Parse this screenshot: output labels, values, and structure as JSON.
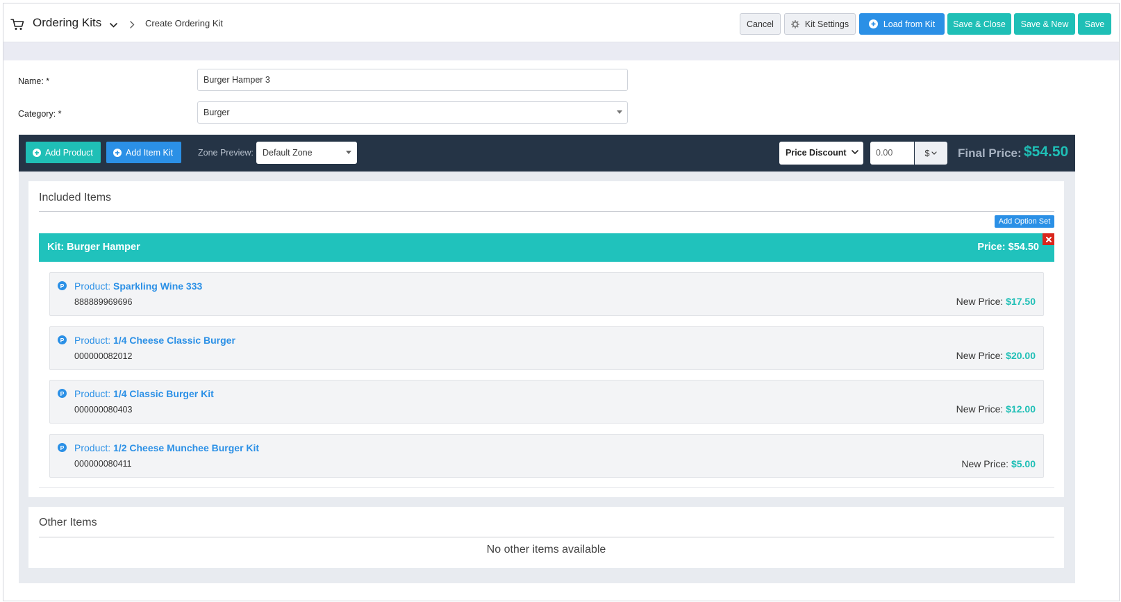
{
  "header": {
    "app_title": "Ordering Kits",
    "breadcrumb": "Create Ordering Kit",
    "buttons": {
      "cancel": "Cancel",
      "kit_settings": "Kit Settings",
      "load_from_kit": "Load from Kit",
      "save_close": "Save & Close",
      "save_new": "Save & New",
      "save": "Save"
    }
  },
  "form": {
    "name_label": "Name: *",
    "name_value": "Burger Hamper 3",
    "category_label": "Category: *",
    "category_value": "Burger"
  },
  "toolbar": {
    "add_product": "Add Product",
    "add_item_kit": "Add Item Kit",
    "zone_label": "Zone Preview:",
    "zone_value": "Default Zone",
    "discount_type": "Price Discount",
    "discount_value": "0.00",
    "currency": "$",
    "final_price_label": "Final Price:",
    "final_price_value": "$54.50"
  },
  "included": {
    "title": "Included Items",
    "add_option_set": "Add Option Set",
    "kit_label": "Kit: Burger Hamper",
    "kit_price": "Price: $54.50",
    "product_prefix": "Product: ",
    "new_price_label": "New Price: ",
    "products": [
      {
        "name": "Sparkling Wine 333",
        "sku": "888889969696",
        "new_price": "$17.50"
      },
      {
        "name": "1/4 Cheese Classic Burger",
        "sku": "000000082012",
        "new_price": "$20.00"
      },
      {
        "name": "1/4 Classic Burger Kit",
        "sku": "000000080403",
        "new_price": "$12.00"
      },
      {
        "name": "1/2 Cheese Munchee Burger Kit",
        "sku": "000000080411",
        "new_price": "$5.00"
      }
    ]
  },
  "other": {
    "title": "Other Items",
    "empty_text": "No other items available"
  },
  "colors": {
    "teal": "#1fbfb6",
    "blue": "#2b90e6",
    "toolbar_bg": "#253446",
    "danger": "#d9261c"
  },
  "icons": {
    "cart": "cart-icon",
    "gear": "gear-icon",
    "plus_circle": "plus-circle-icon",
    "product_badge": "product-badge-icon",
    "close": "close-icon"
  }
}
